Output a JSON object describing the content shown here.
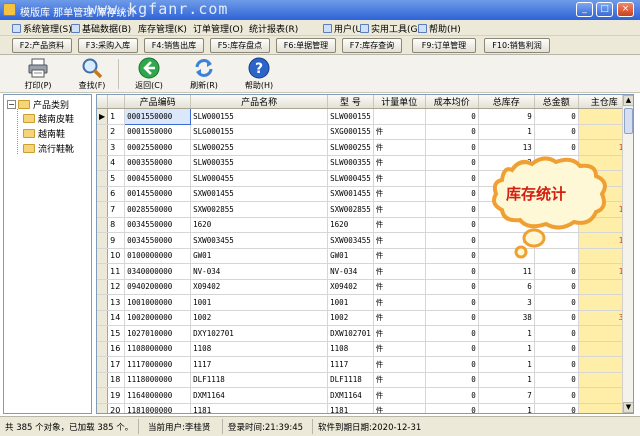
{
  "window": {
    "title": "模版库 那单管理  库存统计",
    "watermark": "www.kgfanr.com",
    "controls": [
      "_",
      "□",
      "×"
    ]
  },
  "menu": [
    "系统管理(S)",
    "基础数据(B)",
    "库存管理(K)",
    "订单管理(O)",
    "统计报表(R)",
    "用户(U)",
    "实用工具(G)",
    "帮助(H)"
  ],
  "fkeys": [
    "F2:产品资料",
    "F3:采购入库",
    "F4:销售出库",
    "F5:库存盘点",
    "F6:单据管理",
    "F7:库存查询",
    "F9:订单管理",
    "F10:销售利润"
  ],
  "toolbar": [
    "打印(P)",
    "查找(F)",
    "返回(C)",
    "刷新(R)",
    "帮助(H)"
  ],
  "tree": {
    "root": "产品类别",
    "children": [
      "越南皮鞋",
      "越南鞋",
      "流行鞋靴"
    ]
  },
  "columns": [
    "产品编码",
    "产品名称",
    "型 号",
    "计量单位",
    "成本均价",
    "总库存",
    "总金额",
    "主仓库"
  ],
  "rows": [
    [
      "1",
      "0001550000",
      "SLW000155",
      "SLW000155",
      "",
      "0",
      "9",
      "0",
      "9"
    ],
    [
      "2",
      "0001550000",
      "SLG000155",
      "SXG000155",
      "件",
      "0",
      "1",
      "0",
      "1"
    ],
    [
      "3",
      "0002550000",
      "SLW000255",
      "SLW000255",
      "件",
      "0",
      "13",
      "0",
      "13"
    ],
    [
      "4",
      "0003550000",
      "SLW000355",
      "SLW000355",
      "件",
      "0",
      "2",
      "0",
      "2"
    ],
    [
      "5",
      "0004550000",
      "SLW000455",
      "SLW000455",
      "件",
      "0",
      "",
      "",
      "1"
    ],
    [
      "6",
      "0014550000",
      "SXW001455",
      "SXW001455",
      "件",
      "0",
      "",
      "",
      "1"
    ],
    [
      "7",
      "0028550000",
      "SXW002855",
      "SXW002855",
      "件",
      "0",
      "",
      "",
      "10"
    ],
    [
      "8",
      "0034550000",
      "1620",
      "1620",
      "件",
      "0",
      "",
      "",
      "1"
    ],
    [
      "9",
      "0034550000",
      "SXW003455",
      "SXW003455",
      "件",
      "0",
      "15",
      "",
      "15"
    ],
    [
      "10",
      "0100000000",
      "GW01",
      "GW01",
      "件",
      "0",
      "",
      "",
      "2"
    ],
    [
      "11",
      "0340000000",
      "NV-034",
      "NV-034",
      "件",
      "0",
      "11",
      "0",
      "11"
    ],
    [
      "12",
      "0940200000",
      "X09402",
      "X09402",
      "件",
      "0",
      "6",
      "0",
      "6"
    ],
    [
      "13",
      "1001000000",
      "1001",
      "1001",
      "件",
      "0",
      "3",
      "0",
      "3"
    ],
    [
      "14",
      "1002000000",
      "1002",
      "1002",
      "件",
      "0",
      "38",
      "0",
      "38"
    ],
    [
      "15",
      "1027010000",
      "DXY102701",
      "DXW102701",
      "件",
      "0",
      "1",
      "0",
      "1"
    ],
    [
      "16",
      "1108000000",
      "1108",
      "1108",
      "件",
      "0",
      "1",
      "0",
      "1"
    ],
    [
      "17",
      "1117000000",
      "1117",
      "1117",
      "件",
      "0",
      "1",
      "0",
      "1"
    ],
    [
      "18",
      "1118000000",
      "DLF1118",
      "DLF1118",
      "件",
      "0",
      "1",
      "0",
      "1"
    ],
    [
      "19",
      "1164000000",
      "DXM1164",
      "DXM1164",
      "件",
      "0",
      "7",
      "0",
      "7"
    ],
    [
      "20",
      "1181000000",
      "1181",
      "1181",
      "件",
      "0",
      "1",
      "0",
      "1"
    ]
  ],
  "status": [
    "共 385 个对象，已加载 385 个。",
    "当前用户:李桂贤",
    "登录时间:21:39:45",
    "软件到期日期:2020-12-31"
  ],
  "bubble": "库存统计",
  "colors": {
    "accent": "#2f63d6",
    "stock_bg": "#ffeea8",
    "stock_text": "#e0321c",
    "bubble": "#f5a63e"
  }
}
